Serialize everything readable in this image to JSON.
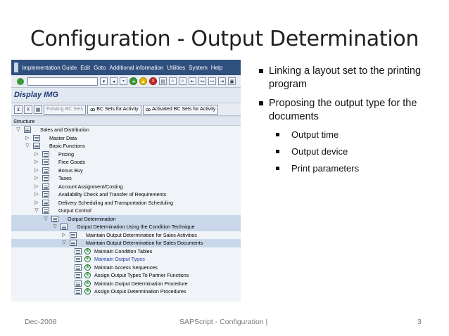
{
  "slide": {
    "title": "Configuration - Output Determination",
    "footer_left": "Dec-2008",
    "footer_center": "SAPScript - Configuration |",
    "footer_right": "3"
  },
  "sap": {
    "menu": [
      "Implementation Guide",
      "Edit",
      "Goto",
      "Additional information",
      "Utilities",
      "System",
      "Help"
    ],
    "screen_title": "Display IMG",
    "buttons": {
      "existing": "Existing BC Sets",
      "bc_activity": "BC Sets for Activity",
      "activated": "Activated BC Sets for Activity"
    },
    "tree_header": "Structure",
    "tree": [
      {
        "label": "Sales and Distribution",
        "level": 1,
        "exp": "▽",
        "exe": false,
        "sel": false
      },
      {
        "label": "Master Data",
        "level": 2,
        "exp": "▷",
        "exe": false,
        "sel": false
      },
      {
        "label": "Basic Functions",
        "level": 2,
        "exp": "▽",
        "exe": false,
        "sel": false
      },
      {
        "label": "Pricing",
        "level": 3,
        "exp": "▷",
        "exe": false,
        "sel": false
      },
      {
        "label": "Free Goods",
        "level": 3,
        "exp": "▷",
        "exe": false,
        "sel": false
      },
      {
        "label": "Bonus Buy",
        "level": 3,
        "exp": "▷",
        "exe": false,
        "sel": false
      },
      {
        "label": "Taxes",
        "level": 3,
        "exp": "▷",
        "exe": false,
        "sel": false
      },
      {
        "label": "Account Assignment/Costing",
        "level": 3,
        "exp": "▷",
        "exe": false,
        "sel": false
      },
      {
        "label": "Availability Check and Transfer of Requirements",
        "level": 3,
        "exp": "▷",
        "exe": false,
        "sel": false
      },
      {
        "label": "Delivery Scheduling and Transportation Scheduling",
        "level": 3,
        "exp": "▷",
        "exe": false,
        "sel": false
      },
      {
        "label": "Output Control",
        "level": 3,
        "exp": "▽",
        "exe": false,
        "sel": false
      },
      {
        "label": "Output Determination",
        "level": 4,
        "exp": "▽",
        "exe": false,
        "sel": true
      },
      {
        "label": "Output Determination Using the Condition Technique",
        "level": 5,
        "exp": "▽",
        "exe": false,
        "sel": true
      },
      {
        "label": "Maintain Output Determination for Sales Activities",
        "level": 6,
        "exp": "▷",
        "exe": false,
        "sel": false
      },
      {
        "label": "Maintain Output Determination for Sales Documents",
        "level": 6,
        "exp": "▽",
        "exe": false,
        "sel": true
      },
      {
        "label": "Maintain Condition Tables",
        "level": 7,
        "exp": "",
        "exe": true,
        "sel": false
      },
      {
        "label": "Maintain Output Types",
        "level": 7,
        "exp": "",
        "exe": true,
        "sel": false,
        "blue": true
      },
      {
        "label": "Maintain Access Sequences",
        "level": 7,
        "exp": "",
        "exe": true,
        "sel": false
      },
      {
        "label": "Assign Output Types To Partner Functions",
        "level": 7,
        "exp": "",
        "exe": true,
        "sel": false
      },
      {
        "label": "Maintain Output Determination Procedure",
        "level": 7,
        "exp": "",
        "exe": true,
        "sel": false
      },
      {
        "label": "Assign Output Determination Procedures",
        "level": 7,
        "exp": "",
        "exe": true,
        "sel": false
      }
    ]
  },
  "bullets": [
    {
      "text": "Linking a layout set to the printing program",
      "level": 1
    },
    {
      "text": "Proposing the output type for the documents",
      "level": 1
    },
    {
      "text": "Output time",
      "level": 2
    },
    {
      "text": "Output device",
      "level": 2
    },
    {
      "text": "Print parameters",
      "level": 2
    }
  ]
}
